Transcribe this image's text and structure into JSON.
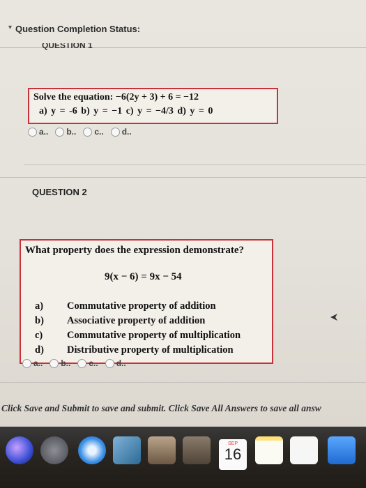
{
  "status": {
    "title": "Question Completion Status:",
    "chevron": "▾"
  },
  "question1": {
    "heading_fragment": "QUESTION 1",
    "prompt": "Solve the equation: −6(2y + 3) + 6 = −12",
    "options_inline": "a)  y = -6    b)  y = −1    c)  y = −4/3    d)  y = 0",
    "radio_labels": [
      "a..",
      "b..",
      "c..",
      "d.."
    ]
  },
  "question2": {
    "heading": "QUESTION 2",
    "prompt": "What property does the expression demonstrate?",
    "expression": "9(x − 6) = 9x − 54",
    "options": [
      {
        "letter": "a)",
        "text": "Commutative property of addition"
      },
      {
        "letter": "b)",
        "text": "Associative property of addition"
      },
      {
        "letter": "c)",
        "text": "Commutative property of multiplication"
      },
      {
        "letter": "d)",
        "text": "Distributive property of multiplication"
      }
    ],
    "radio_labels": [
      "a..",
      "b..",
      "c..",
      "d.."
    ]
  },
  "footer": {
    "instruction": "Click Save and Submit to save and submit. Click Save All Answers to save all answ"
  },
  "dock": {
    "calendar_month": "SEP",
    "calendar_day": "16",
    "icons": [
      "siri-icon",
      "launchpad-rocket-icon",
      "safari-compass-icon",
      "photo-app-icon",
      "folder-icon",
      "calendar-icon",
      "notes-icon",
      "reminders-icon",
      "app-store-icon"
    ]
  },
  "colors": {
    "accent_border": "#c9303a",
    "dock_bg": "#1f1b17"
  }
}
